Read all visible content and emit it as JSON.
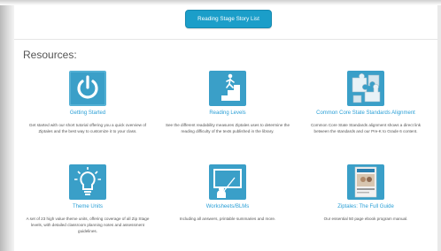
{
  "header": {
    "story_list_button": "Reading Stage Story List"
  },
  "resources": {
    "heading": "Resources:",
    "cards": [
      {
        "icon": "power-icon",
        "title": "Getting Started",
        "description": "Get started with our short tutorial offering you a quick overview of Ziptales and the best way to customize it to your class."
      },
      {
        "icon": "stairs-icon",
        "title": "Reading Levels",
        "description": "See the different readability measures Ziptales uses to determine the reading difficulty of the texts published in the library."
      },
      {
        "icon": "puzzle-icon",
        "title": "Common Core State Standards Alignment",
        "description": "Common Core State Standards alignment shows a direct link between the standards and our Pre-K to Grade 6 content."
      },
      {
        "icon": "lightbulb-icon",
        "title": "Theme Units",
        "description": "A set of 23 high value theme units, offering coverage of all Zip Stage levels, with detailed classroom planning notes and assessment guidelines."
      },
      {
        "icon": "teacher-board-icon",
        "title": "Worksheets/BLMs",
        "description": "Including all answers, printable summaries and more."
      },
      {
        "icon": "guide-book-icon",
        "title": "Ziptales: The Full Guide",
        "description": "Our essential 50 page ebook program manual."
      }
    ]
  },
  "colors": {
    "accent": "#2a9fd6",
    "button": "#1b9ec9",
    "icon_bg": "#3a9fc8"
  }
}
